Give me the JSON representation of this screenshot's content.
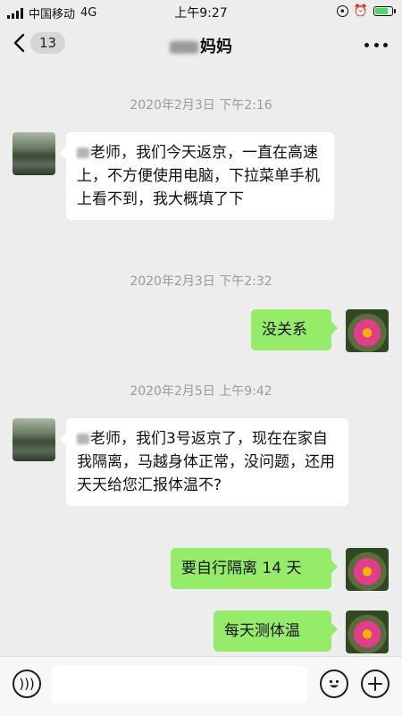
{
  "status_bar": {
    "carrier": "中国移动",
    "network": "4G",
    "time": "上午9:27"
  },
  "header": {
    "unread_count": "13",
    "title": "妈妈"
  },
  "messages": [
    {
      "type": "timestamp",
      "text": "2020年2月3日 下午2:16"
    },
    {
      "type": "incoming",
      "text": "老师，我们今天返京，一直在高速上，不方便使用电脑，下拉菜单手机上看不到，我大概填了下"
    },
    {
      "type": "timestamp",
      "text": "2020年2月3日 下午2:32"
    },
    {
      "type": "outgoing",
      "text": "没关系"
    },
    {
      "type": "timestamp",
      "text": "2020年2月5日 上午9:42"
    },
    {
      "type": "incoming",
      "text": "老师，我们3号返京了，现在在家自我隔离，马越身体正常，没问题，还用天天给您汇报体温不?"
    },
    {
      "type": "outgoing",
      "text": "要自行隔离 14 天"
    },
    {
      "type": "outgoing",
      "text": "每天测体温"
    }
  ],
  "colors": {
    "background": "#ededed",
    "outgoing_bubble": "#95ec69",
    "incoming_bubble": "#ffffff",
    "timestamp": "#9b9b9b"
  }
}
